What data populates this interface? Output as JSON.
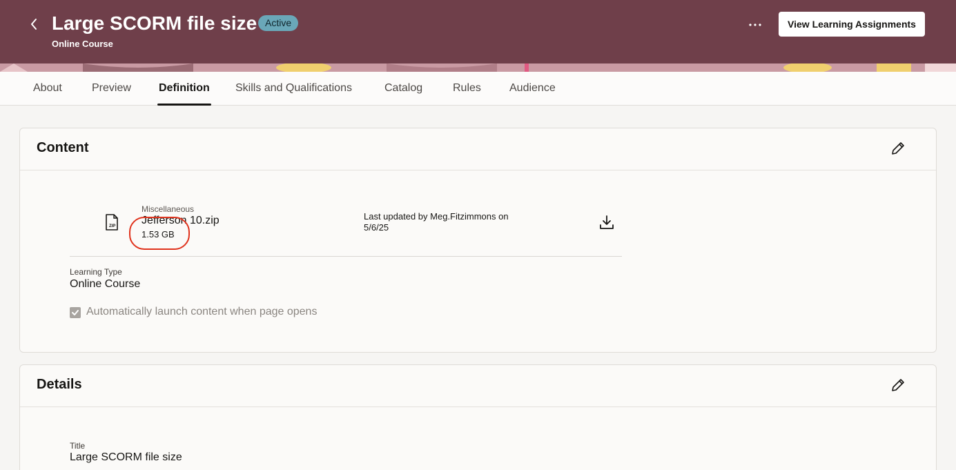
{
  "header": {
    "back_label": "<",
    "title": "Large SCORM file size",
    "status": "Active",
    "subtitle": "Online Course",
    "more_label": "···",
    "primary_action": "View Learning Assignments",
    "colors": {
      "banner": "#6f3f4a",
      "badge": "#6aa7b8"
    }
  },
  "tabs": [
    {
      "label": "About"
    },
    {
      "label": "Preview"
    },
    {
      "label": "Definition",
      "active": true
    },
    {
      "label": "Skills and Qualifications"
    },
    {
      "label": "Catalog"
    },
    {
      "label": "Rules"
    },
    {
      "label": "Audience"
    }
  ],
  "content": {
    "title": "Content",
    "file": {
      "icon": "zip-file-icon",
      "icon_text": "ZIP",
      "category": "Miscellaneous",
      "name": "Jefferson 10.zip",
      "size": "1.53 GB"
    },
    "updated_line1": "Last updated by Meg.Fitzimmons on",
    "updated_line2": "5/6/25",
    "learning_type_label": "Learning Type",
    "learning_type_value": "Online Course",
    "auto_launch_label": "Automatically launch content when page opens",
    "auto_launch_checked": true
  },
  "details": {
    "title": "Details",
    "title_label": "Title",
    "title_value": "Large SCORM file size"
  }
}
